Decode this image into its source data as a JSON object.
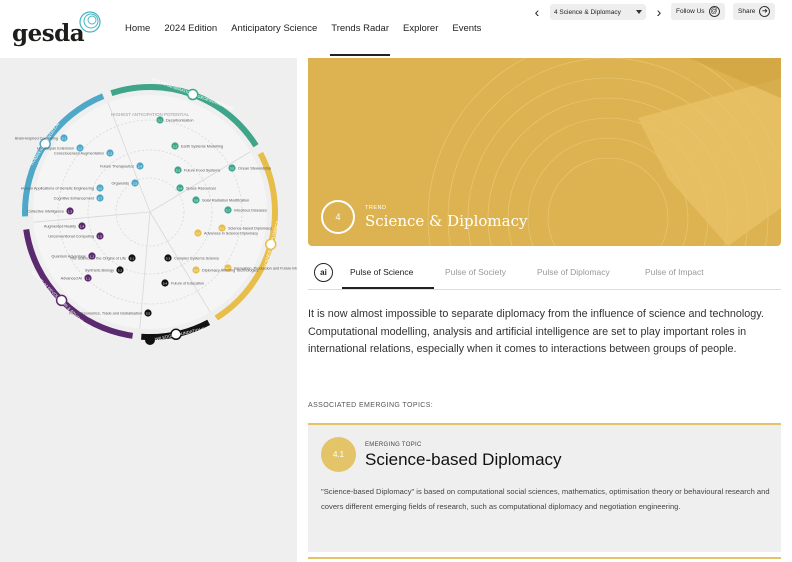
{
  "header": {
    "logo_text": "gesda",
    "nav": [
      {
        "label": "Home"
      },
      {
        "label": "2024 Edition"
      },
      {
        "label": "Anticipatory Science"
      },
      {
        "label": "Trends Radar"
      },
      {
        "label": "Explorer"
      },
      {
        "label": "Events"
      }
    ],
    "active_nav": "Trends Radar",
    "trend_select": "4 Science & Diplomacy",
    "follow_label": "Follow Us",
    "share_label": "Share"
  },
  "radar": {
    "segments": [
      {
        "label": "QUANTUM REVOLUTION & ADVANCED AI",
        "color": "#5b2a6e"
      },
      {
        "label": "HUMAN AUGMENTATION",
        "color": "#4fa8c8"
      },
      {
        "label": "ECO-REGENERATION & GEOENGINEERING",
        "color": "#3fa58a"
      },
      {
        "label": "SCIENCE & DIPLOMACY",
        "color": "#e8be4a"
      },
      {
        "label": "KNOWLEDGE FOUNDATIONS",
        "color": "#111111"
      }
    ],
    "center_label": "HIGHEST ANTICIPATION POTENTIAL",
    "points": [
      {
        "label": "Decarbonisation",
        "code": "3.1",
        "color": "#3fa58a"
      },
      {
        "label": "Earth Systems Modelling",
        "code": "3.2",
        "color": "#3fa58a"
      },
      {
        "label": "Future Food Systems",
        "code": "3.3",
        "color": "#3fa58a"
      },
      {
        "label": "Space Resources",
        "code": "3.4",
        "color": "#3fa58a"
      },
      {
        "label": "Ocean Stewardship",
        "code": "3.5",
        "color": "#3fa58a"
      },
      {
        "label": "Solar Radiation Modification",
        "code": "3.6",
        "color": "#3fa58a"
      },
      {
        "label": "Infectious Diseases",
        "code": "3.7",
        "color": "#3fa58a"
      },
      {
        "label": "Brain-Inspired Computing",
        "code": "2.1",
        "color": "#4fa8c8"
      },
      {
        "label": "Healthspan Extension",
        "code": "2.2",
        "color": "#4fa8c8"
      },
      {
        "label": "Consciousness Augmentation",
        "code": "2.3",
        "color": "#4fa8c8"
      },
      {
        "label": "Future Therapeutics",
        "code": "2.4",
        "color": "#4fa8c8"
      },
      {
        "label": "Organoids",
        "code": "2.5",
        "color": "#4fa8c8"
      },
      {
        "label": "Human Applications of Genetic Engineering",
        "code": "2.6",
        "color": "#4fa8c8"
      },
      {
        "label": "Cognitive Enhancement",
        "code": "2.7",
        "color": "#4fa8c8"
      },
      {
        "label": "Collective Intelligence",
        "code": "1.3",
        "color": "#5b2a6e"
      },
      {
        "label": "Augmented Reality",
        "code": "1.4",
        "color": "#5b2a6e"
      },
      {
        "label": "Unconventional Computing",
        "code": "1.5",
        "color": "#5b2a6e"
      },
      {
        "label": "Quantum Advantage",
        "code": "1.2",
        "color": "#5b2a6e"
      },
      {
        "label": "Advanced AI",
        "code": "1.1",
        "color": "#5b2a6e"
      },
      {
        "label": "The Science of the Origins of Life",
        "code": "5.1",
        "color": "#111111"
      },
      {
        "label": "Synthetic Biology",
        "code": "5.2",
        "color": "#111111"
      },
      {
        "label": "Complex Systems Science",
        "code": "5.3",
        "color": "#111111"
      },
      {
        "label": "Future of Education",
        "code": "5.4",
        "color": "#111111"
      },
      {
        "label": "Future Economics, Trade and Globalisation",
        "code": "5.5",
        "color": "#111111"
      },
      {
        "label": "Advances in Science Diplomacy",
        "code": "4.2",
        "color": "#e8be4a"
      },
      {
        "label": "Science-based Diplomacy",
        "code": "4.1",
        "color": "#e8be4a"
      },
      {
        "label": "Innovation, Production and Future Internet",
        "code": "4.3",
        "color": "#e8be4a"
      },
      {
        "label": "Diplomacy Affecting Technologies",
        "code": "4.4",
        "color": "#e8be4a"
      }
    ]
  },
  "hero": {
    "number": "4",
    "kicker": "TREND",
    "title": "Science & Diplomacy",
    "color": "#dcb350"
  },
  "tabs": {
    "icon_text": "ai",
    "items": [
      {
        "label": "Pulse of Science",
        "active": true
      },
      {
        "label": "Pulse of Society",
        "active": false
      },
      {
        "label": "Pulse of Diplomacy",
        "active": false
      },
      {
        "label": "Pulse of Impact",
        "active": false
      }
    ]
  },
  "body": {
    "paragraph": "It is now almost impossible to separate diplomacy from the influence of science and technology. Computational modelling, analysis and artificial intelligence are set to play important roles in international relations, especially when it comes to interactions between groups of people.",
    "associated_label": "ASSOCIATED EMERGING TOPICS:"
  },
  "topic_card": {
    "code": "4.1",
    "kicker": "EMERGING TOPIC",
    "title": "Science-based Diplomacy",
    "description": "\"Science-based Diplomacy\" is based on computational social sciences, mathematics, optimisation theory or behavioural research and covers different emerging fields of research, such as computational diplomacy and negotiation engineering.",
    "accent": "#e4c468"
  }
}
